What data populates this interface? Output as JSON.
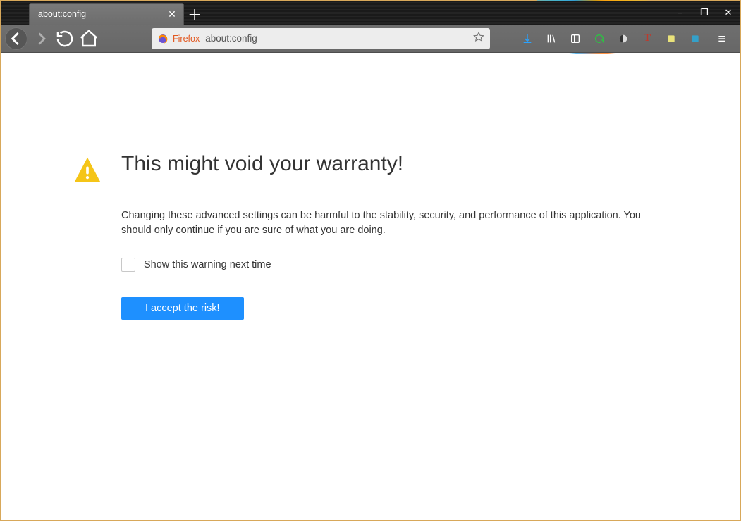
{
  "tab": {
    "title": "about:config"
  },
  "url": {
    "identity_label": "Firefox",
    "value": "about:config"
  },
  "icons": {
    "back": "back-icon",
    "forward": "forward-icon",
    "reload": "reload-icon",
    "home": "home-icon",
    "star": "star-icon",
    "download": "download-icon",
    "library": "library-icon",
    "reader": "reader-icon",
    "sync": "sync-icon",
    "shield": "shield-icon",
    "letter_t": "T",
    "ext1": "ext-icon",
    "ext2": "ext-icon",
    "menu": "hamburger-icon",
    "close_tab": "close-icon",
    "new_tab": "plus-icon"
  },
  "window_controls": {
    "min": "−",
    "max": "❐",
    "close": "✕"
  },
  "warning": {
    "title": "This might void your warranty!",
    "paragraph": "Changing these advanced settings can be harmful to the stability, security, and performance of this application. You should only continue if you are sure of what you are doing.",
    "checkbox_label": "Show this warning next time",
    "checkbox_checked": false,
    "accept_label": "I accept the risk!"
  }
}
